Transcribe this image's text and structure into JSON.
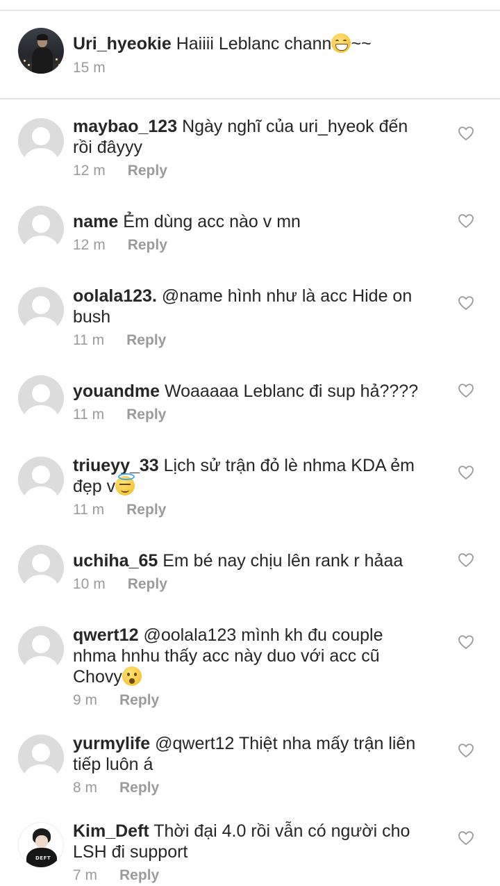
{
  "caption": {
    "username": "Uri_hyeokie",
    "text": "Haiiii Leblanc chann",
    "emoji": "grin-emoji",
    "suffix": "~~",
    "time": "15 m"
  },
  "reply_label": "Reply",
  "comments": [
    {
      "username": "maybao_123",
      "text_1": "Ngày nghĩ của uri_hyeok đến",
      "text_2": "rồi đâyyy",
      "time": "12 m"
    },
    {
      "username": "name",
      "text_1": "Ẻm dùng acc nào v mn",
      "time": "12 m"
    },
    {
      "username": "oolala123.",
      "text_1": "@name hình như là acc Hide on",
      "text_2": "bush",
      "time": "11 m"
    },
    {
      "username": "youandme",
      "text_1": "Woaaaaa Leblanc đi sup hả????",
      "time": "11 m"
    },
    {
      "username": "triueyy_33",
      "text_1": "Lịch sử trận đỏ lè nhma KDA ẻm",
      "text_2": "đẹp v",
      "emoji": "halo-emoji",
      "time": "11 m"
    },
    {
      "username": "uchiha_65",
      "text_1": "Em bé nay chịu lên rank r hảaa",
      "time": "10 m"
    },
    {
      "username": "qwert12",
      "text_1": "@oolala123 mình kh đu couple",
      "text_2": "nhma hnhu thấy acc này duo với acc cũ",
      "text_3": "Chovy",
      "emoji": "astonished-emoji",
      "time": "9 m"
    },
    {
      "username": "yurmylife",
      "text_1": "@qwert12 Thiệt nha mấy trận liên",
      "text_2": "tiếp luôn á",
      "time": "8 m"
    },
    {
      "username": "Kim_Deft",
      "text_1": "Thời đại 4.0 rồi vẫn có người cho",
      "text_2": "LSH đi support",
      "time": "7 m"
    }
  ],
  "avatar_logo_text": "DEFT",
  "colors": {
    "text": "#262626",
    "meta": "#9b9b9b",
    "divider": "#e1e1e1",
    "default_avatar": "#dcdcdc"
  }
}
